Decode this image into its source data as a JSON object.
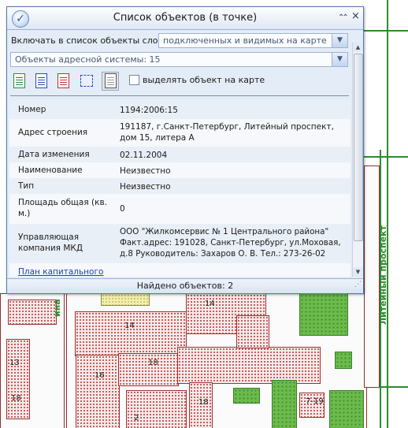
{
  "window": {
    "title": "Список объектов (в точке)",
    "collapse_glyph": "⌃",
    "close_glyph": "×",
    "app_icon": "checkmark-icon"
  },
  "filters": {
    "layers_label": "Включать в список объекты слоев:",
    "layers_value": "подключенных и видимых на карте",
    "objects_value": "Объекты адресной системы: 15"
  },
  "toolbar": {
    "highlight_label": "выделять объект на карте",
    "highlight_checked": false,
    "tools": [
      "export-excel-icon",
      "export-word-icon",
      "export-pdf-icon",
      "select-area-icon",
      "print-icon"
    ]
  },
  "details": {
    "rows": [
      {
        "key": "Номер",
        "value": "1194:2006:15"
      },
      {
        "key": "Адрес строения",
        "value": "191187, г.Санкт-Петербург, Литейный проспект, дом 15, литера А"
      },
      {
        "key": "Дата изменения",
        "value": "02.11.2004"
      },
      {
        "key": "Наименование",
        "value": "Неизвестно"
      },
      {
        "key": "Тип",
        "value": "Неизвестно"
      },
      {
        "key": "Площадь общая (кв. м.)",
        "value": "0"
      },
      {
        "key": "Управляющая компания МКД",
        "value": "ООО \"Жилкомсервис № 1 Центрального района\" Факт.адрес: 191028, Санкт-Петербург, ул.Моховая, д.8 Руководитель: Захаров О. В. Тел.: 273-26-02"
      },
      {
        "key": "План капитального ремонта",
        "value": ""
      }
    ]
  },
  "status": {
    "found_text": "Найдено объектов: 2"
  },
  "map": {
    "street_label": "Литейный проспект",
    "street_label_2": "ина",
    "numbers": [
      "14",
      "14",
      "18",
      "16",
      "13",
      "18",
      "7-19",
      "18",
      "2"
    ],
    "colors": {
      "building": "#b83a3a",
      "green_zone": "#6dbb4d",
      "road": "#2f8a2f",
      "panel_border": "#4f79b5",
      "link": "#1f3fb0"
    }
  }
}
